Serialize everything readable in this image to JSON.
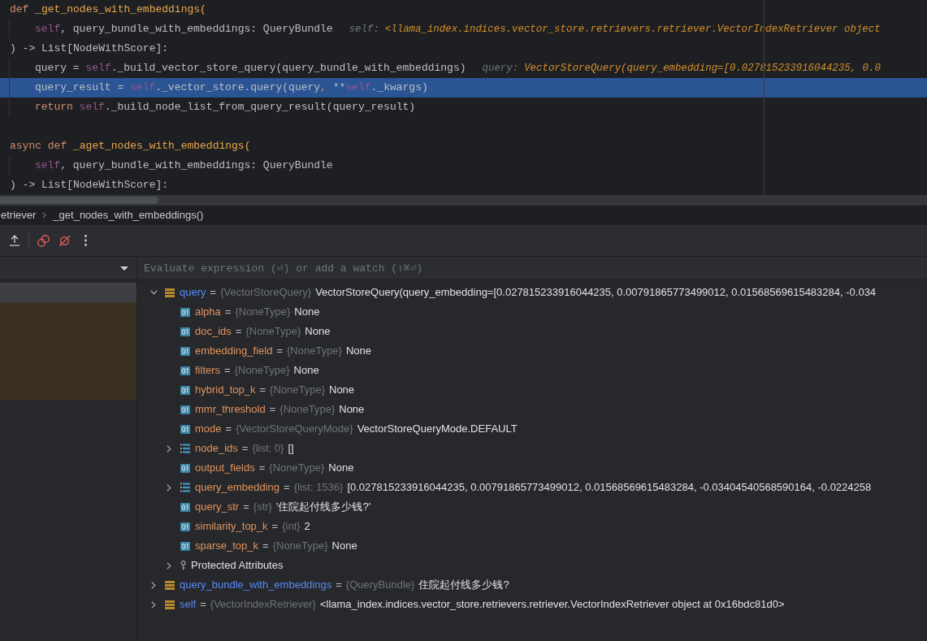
{
  "editor": {
    "blocks": [
      {
        "lines": [
          {
            "highlighted": false,
            "tokens": [
              {
                "text": "def ",
                "kind": "keyword"
              },
              {
                "text": "_get_nodes_with_embeddings(",
                "kind": "function"
              }
            ],
            "children": [
              {
                "highlighted": false,
                "tokens": [
                  {
                    "text": "self",
                    "kind": "self"
                  },
                  {
                    "text": ", query_bundle_with_embeddings: QueryBundle",
                    "kind": "plain"
                  }
                ],
                "hint": {
                  "label": "self:",
                  "value": "<llama_index.indices.vector_store.retrievers.retriever.VectorIndexRetriever object"
                }
              }
            ]
          },
          {
            "highlighted": false,
            "tokens": [
              {
                "text": ") -> List[NodeWithScore]:",
                "kind": "plain"
              }
            ],
            "children": [
              {
                "highlighted": false,
                "tokens": [
                  {
                    "text": "query = ",
                    "kind": "plain"
                  },
                  {
                    "text": "self",
                    "kind": "self"
                  },
                  {
                    "text": "._build_vector_store_query(query_bundle_with_embeddings)",
                    "kind": "plain"
                  }
                ],
                "hint": {
                  "label": "query:",
                  "value": "VectorStoreQuery(query_embedding=[0.027815233916044235, 0.0"
                }
              },
              {
                "highlighted": true,
                "tokens": [
                  {
                    "text": "query_result = ",
                    "kind": "plain"
                  },
                  {
                    "text": "self",
                    "kind": "self"
                  },
                  {
                    "text": "._vector_store.query(query",
                    "kind": "plain"
                  },
                  {
                    "text": ",",
                    "kind": "keyword"
                  },
                  {
                    "text": " **",
                    "kind": "plain"
                  },
                  {
                    "text": "self",
                    "kind": "self"
                  },
                  {
                    "text": "._kwargs)",
                    "kind": "plain"
                  }
                ]
              },
              {
                "highlighted": false,
                "tokens": [
                  {
                    "text": "return ",
                    "kind": "keyword"
                  },
                  {
                    "text": "self",
                    "kind": "self"
                  },
                  {
                    "text": "._build_node_list_from_query_result(query_result)",
                    "kind": "plain"
                  }
                ]
              }
            ]
          }
        ]
      },
      {
        "lines": [
          {
            "highlighted": false,
            "tokens": [
              {
                "text": "async def ",
                "kind": "keyword"
              },
              {
                "text": "_aget_nodes_with_embeddings(",
                "kind": "function"
              }
            ],
            "children": [
              {
                "highlighted": false,
                "tokens": [
                  {
                    "text": "self",
                    "kind": "self"
                  },
                  {
                    "text": ", query_bundle_with_embeddings: QueryBundle",
                    "kind": "plain"
                  }
                ]
              }
            ]
          },
          {
            "highlighted": false,
            "tokens": [
              {
                "text": ") -> List[NodeWithScore]:",
                "kind": "plain"
              }
            ]
          }
        ]
      }
    ]
  },
  "breadcrumbs": [
    "etriever",
    "_get_nodes_with_embeddings()"
  ],
  "frames": [
    {
      "kind": "user",
      "selected": true
    },
    {
      "kind": "library",
      "selected": false
    },
    {
      "kind": "library",
      "selected": false
    },
    {
      "kind": "library",
      "selected": false
    },
    {
      "kind": "library",
      "selected": false
    },
    {
      "kind": "library",
      "selected": false
    }
  ],
  "watch_field": {
    "placeholder": "Evaluate expression (⏎) or add a watch (⇧⌘⏎)"
  },
  "variables": [
    {
      "kind": "object",
      "name": "query",
      "operator": "=",
      "type": "{VectorStoreQuery}",
      "value": "VectorStoreQuery(query_embedding=[0.027815233916044235, 0.00791865773499012, 0.01568569615483284, -0.034",
      "expanded": true,
      "children": [
        {
          "kind": "field",
          "name": "alpha",
          "operator": "=",
          "type": "{NoneType}",
          "value": "None"
        },
        {
          "kind": "field",
          "name": "doc_ids",
          "operator": "=",
          "type": "{NoneType}",
          "value": "None"
        },
        {
          "kind": "field",
          "name": "embedding_field",
          "operator": "=",
          "type": "{NoneType}",
          "value": "None"
        },
        {
          "kind": "field",
          "name": "filters",
          "operator": "=",
          "type": "{NoneType}",
          "value": "None"
        },
        {
          "kind": "field",
          "name": "hybrid_top_k",
          "operator": "=",
          "type": "{NoneType}",
          "value": "None"
        },
        {
          "kind": "field",
          "name": "mmr_threshold",
          "operator": "=",
          "type": "{NoneType}",
          "value": "None"
        },
        {
          "kind": "field",
          "name": "mode",
          "operator": "=",
          "type": "{VectorStoreQueryMode}",
          "value": "VectorStoreQueryMode.DEFAULT"
        },
        {
          "kind": "list",
          "name": "node_ids",
          "operator": "=",
          "type": "{list: 0}",
          "value": "[]",
          "expanded": false
        },
        {
          "kind": "field",
          "name": "output_fields",
          "operator": "=",
          "type": "{NoneType}",
          "value": "None"
        },
        {
          "kind": "list",
          "name": "query_embedding",
          "operator": "=",
          "type": "{list: 1536}",
          "value": "[0.027815233916044235, 0.00791865773499012, 0.01568569615483284, -0.03404540568590164, -0.0224258",
          "expanded": false
        },
        {
          "kind": "field",
          "name": "query_str",
          "operator": "=",
          "type": "{str}",
          "value": "'住院起付线多少钱?'"
        },
        {
          "kind": "field",
          "name": "similarity_top_k",
          "operator": "=",
          "type": "{int}",
          "value": "2"
        },
        {
          "kind": "field",
          "name": "sparse_top_k",
          "operator": "=",
          "type": "{NoneType}",
          "value": "None"
        },
        {
          "kind": "group",
          "name": "Protected Attributes",
          "expanded": false
        }
      ]
    },
    {
      "kind": "object",
      "name": "query_bundle_with_embeddings",
      "operator": "=",
      "type": "{QueryBundle}",
      "value": "住院起付线多少钱?",
      "expanded": false
    },
    {
      "kind": "object",
      "name": "self",
      "operator": "=",
      "type": "{VectorIndexRetriever}",
      "value": "<llama_index.indices.vector_store.retrievers.retriever.VectorIndexRetriever object at 0x16bdc81d0>",
      "expanded": false
    }
  ]
}
